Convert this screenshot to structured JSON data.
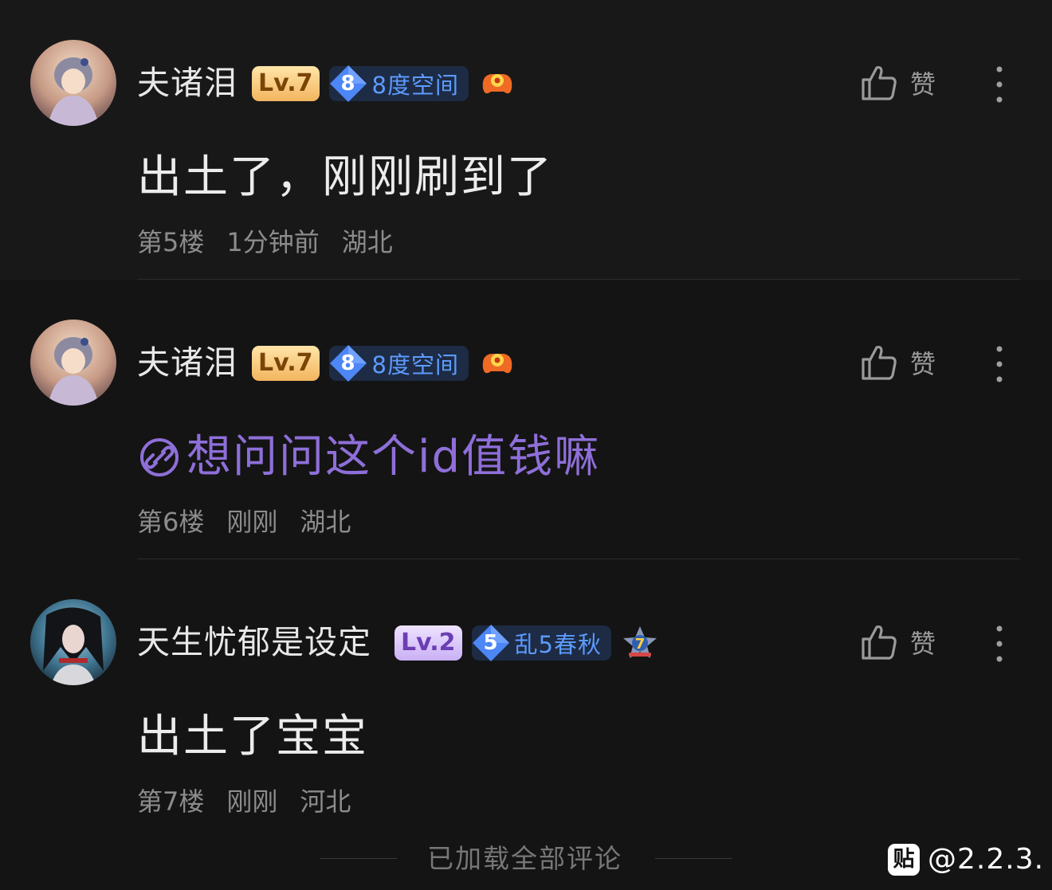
{
  "comments": [
    {
      "username": "夫诸泪",
      "level": "Lv.7",
      "fan_number": "8",
      "fan_label": "8度空间",
      "medal_icon": "game-controller-medal",
      "text": "出土了，刚刚刷到了",
      "floor": "第5楼",
      "time": "1分钟前",
      "location": "湖北",
      "like_label": "赞"
    },
    {
      "username": "夫诸泪",
      "level": "Lv.7",
      "fan_number": "8",
      "fan_label": "8度空间",
      "medal_icon": "game-controller-medal",
      "text": "想问问这个id值钱嘛",
      "text_is_link": true,
      "floor": "第6楼",
      "time": "刚刚",
      "location": "湖北",
      "like_label": "赞"
    },
    {
      "username": "天生忧郁是设定",
      "level": "Lv.2",
      "fan_number": "5",
      "fan_label": "乱5春秋",
      "medal_icon": "star-7-medal",
      "text": "出土了宝宝",
      "floor": "第7楼",
      "time": "刚刚",
      "location": "河北",
      "like_label": "赞"
    }
  ],
  "footer": {
    "text": "已加载全部评论"
  },
  "watermark": {
    "logo": "贴",
    "text": "@2.2.3."
  },
  "colors": {
    "background": "#141414",
    "link": "#8e6fd9",
    "fan_text": "#5d9bff",
    "level_gold": "#f2b55f",
    "level_purple": "#c9b0f5"
  }
}
